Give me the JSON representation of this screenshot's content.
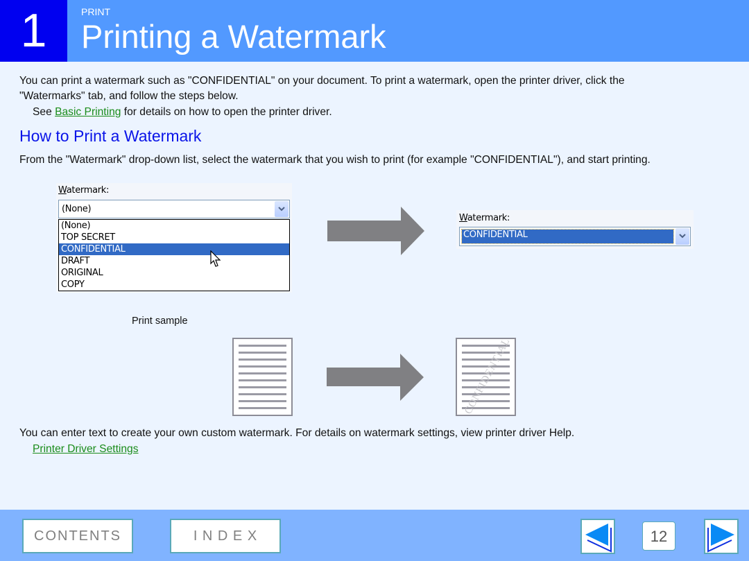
{
  "header": {
    "chapter_number": "1",
    "kicker": "PRINT",
    "title": "Printing a Watermark"
  },
  "intro": {
    "line1": "You can print a watermark such as \"CONFIDENTIAL\" on your document. To print a watermark, open the printer driver, click the",
    "line2": "\"Watermarks\" tab, and follow the steps below.",
    "see_prefix": "See ",
    "see_link": "Basic Printing",
    "see_suffix": " for details on how to open the printer driver."
  },
  "section": {
    "heading": "How to Print a Watermark",
    "instruction": "From the \"Watermark\" drop-down list, select the watermark that you wish to print (for example \"CONFIDENTIAL\"), and start printing."
  },
  "dropdown_before": {
    "label_accel": "W",
    "label_rest": "atermark:",
    "value": "(None)",
    "options": [
      "(None)",
      "TOP SECRET",
      "CONFIDENTIAL",
      "DRAFT",
      "ORIGINAL",
      "COPY"
    ],
    "highlighted": "CONFIDENTIAL"
  },
  "dropdown_after": {
    "label_accel": "W",
    "label_rest": "atermark:",
    "value": "CONFIDENTIAL"
  },
  "print_sample": {
    "label": "Print sample",
    "watermark_text": "CONFIDENTIAL"
  },
  "outro": {
    "text": "You can enter text to create your own custom watermark. For details on watermark settings, view printer driver Help.",
    "link": "Printer Driver Settings"
  },
  "footer": {
    "contents_label": "CONTENTS",
    "index_label": "I N D E X",
    "page_number": "12",
    "prev_icon": "triangle-left-icon",
    "next_icon": "triangle-right-icon"
  },
  "colors": {
    "header_bg": "#5299ff",
    "chapter_bg": "#0000f0",
    "heading": "#0a14e8",
    "link": "#1a8c1a",
    "footer_bg": "#80b3ff",
    "selection": "#316ac5"
  }
}
